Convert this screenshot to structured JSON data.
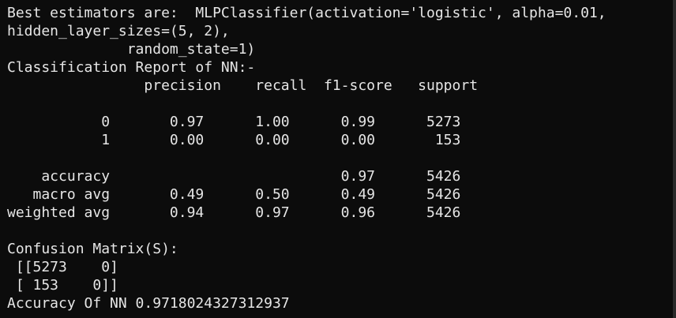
{
  "terminal": {
    "lines": [
      "Best estimators are:  MLPClassifier(activation='logistic', alpha=0.01,",
      "hidden_layer_sizes=(5, 2),",
      "              random_state=1)",
      "Classification Report of NN:-",
      "                precision    recall  f1-score   support",
      "",
      "           0       0.97      1.00      0.99      5273",
      "           1       0.00      0.00      0.00       153",
      "",
      "    accuracy                           0.97      5426",
      "   macro avg       0.49      0.50      0.49      5426",
      "weighted avg       0.94      0.97      0.96      5426",
      "",
      "Confusion Matrix(S):",
      " [[5273    0]",
      " [ 153    0]]",
      "Accuracy Of NN 0.9718024327312937"
    ]
  },
  "colors": {
    "background": "#0c0c0c",
    "text": "#e6e6e6"
  }
}
